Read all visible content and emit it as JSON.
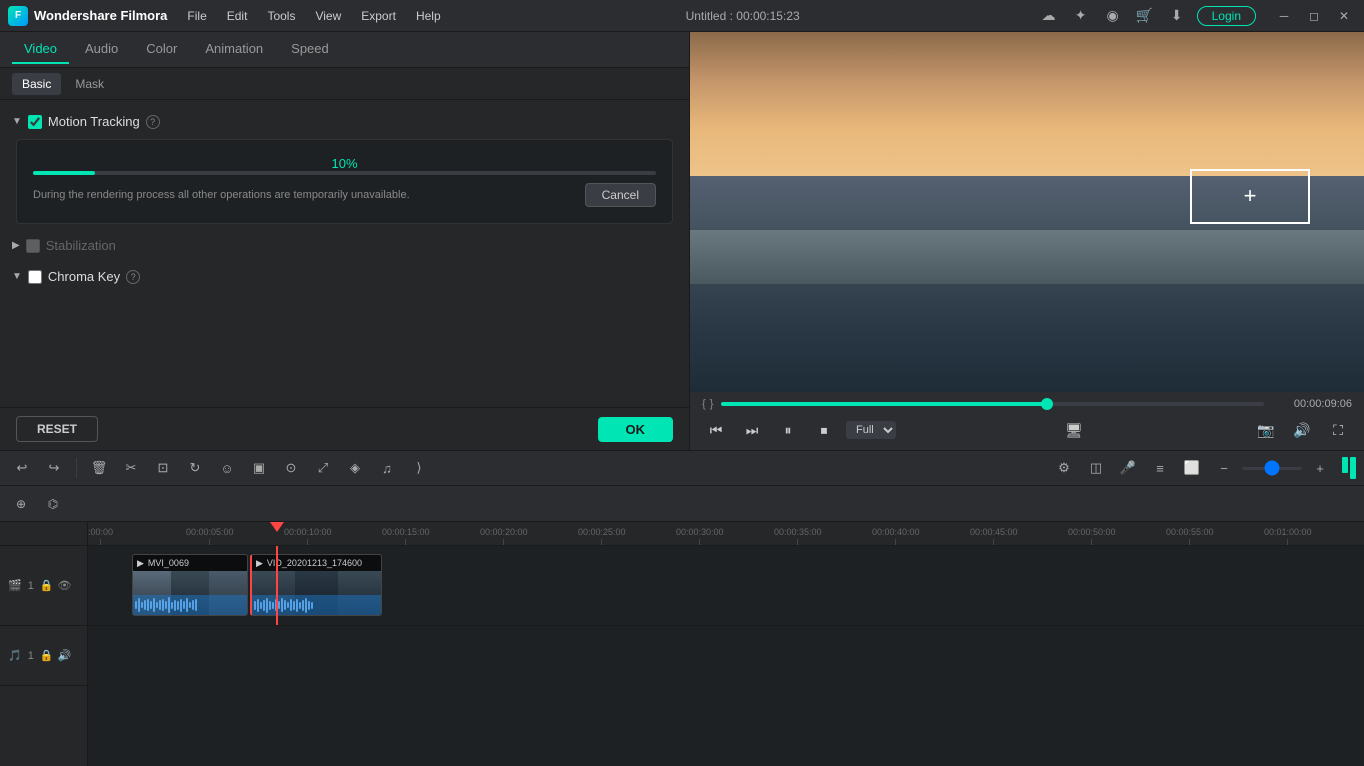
{
  "app": {
    "name": "Wondershare Filmora",
    "title": "Untitled : 00:00:15:23"
  },
  "menu": {
    "items": [
      "File",
      "Edit",
      "Tools",
      "View",
      "Export",
      "Help"
    ]
  },
  "titlebar": {
    "login_label": "Login",
    "icons": [
      "cloud",
      "sun",
      "headset",
      "cart",
      "box",
      "minimize",
      "restore",
      "close"
    ]
  },
  "tabs": {
    "main": [
      "Video",
      "Audio",
      "Color",
      "Animation",
      "Speed"
    ],
    "active_main": "Video",
    "sub": [
      "Basic",
      "Mask"
    ],
    "active_sub": "Basic"
  },
  "sections": {
    "motion_tracking": {
      "label": "Motion Tracking",
      "enabled": true,
      "progress": {
        "percent": "10%",
        "note": "During the rendering process all other operations are temporarily unavailable.",
        "cancel_label": "Cancel"
      }
    },
    "stabilization": {
      "label": "Stabilization",
      "enabled": false
    },
    "chroma_key": {
      "label": "Chroma Key",
      "enabled": false
    }
  },
  "panel_bottom": {
    "reset_label": "RESET",
    "ok_label": "OK"
  },
  "playback": {
    "time_display": "00:00:09:06",
    "quality": "Full",
    "controls": [
      "skip-back",
      "step-back",
      "play",
      "stop",
      "skip-forward"
    ]
  },
  "toolbar": {
    "buttons": [
      "undo",
      "redo",
      "delete",
      "cut",
      "crop",
      "rotate",
      "emoji",
      "image",
      "timer",
      "transform",
      "color",
      "audio",
      "split"
    ],
    "zoom_label": "zoom"
  },
  "timeline": {
    "ruler_marks": [
      ":00:00",
      "00:00:05:00",
      "00:00:10:00",
      "00:00:15:00",
      "00:00:20:00",
      "00:00:25:00",
      "00:00:30:00",
      "00:00:35:00",
      "00:00:40:00",
      "00:00:45:00",
      "00:00:50:00",
      "00:00:55:00",
      "00:01:00:00"
    ],
    "tracks": [
      {
        "id": "V1",
        "label": "1",
        "type": "video",
        "clips": [
          {
            "name": "MVI_0069",
            "start": 0,
            "width": 118
          },
          {
            "name": "VID_20201213_174600",
            "start": 118,
            "width": 130
          }
        ]
      }
    ],
    "audio_track": {
      "id": "A1",
      "label": "1"
    }
  }
}
